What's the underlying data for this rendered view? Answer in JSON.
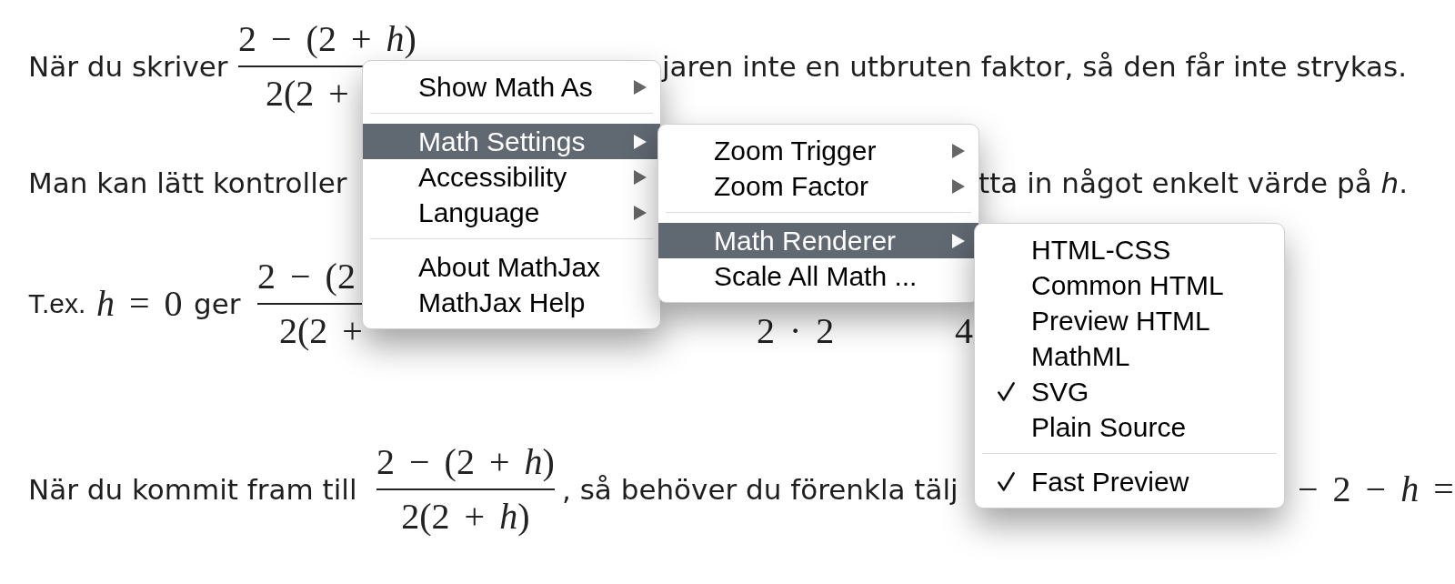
{
  "content": {
    "lines": [
      {
        "fragments": [
          {
            "kind": "text",
            "text": "När du skriver"
          },
          {
            "kind": "fraction",
            "numerator": "2 − (2 + *h*)",
            "denominator": "2(2 +"
          },
          {
            "kind": "text",
            "text": "jaren inte en utbruten faktor, så den får inte strykas."
          }
        ]
      },
      {
        "fragments": [
          {
            "kind": "text",
            "text": "Man kan lätt kontroller"
          },
          {
            "kind": "text",
            "text": "tta in något enkelt värde på *h*."
          }
        ]
      },
      {
        "fragments": [
          {
            "kind": "text",
            "text": "T.ex."
          },
          {
            "kind": "math",
            "text": "*h* = 0"
          },
          {
            "kind": "text",
            "text": "ger"
          },
          {
            "kind": "fraction",
            "numerator": "2 − (2",
            "denominator": "2(2 +"
          },
          {
            "kind": "denominator",
            "text": "2 · 2"
          },
          {
            "kind": "denominator",
            "text": "4"
          }
        ]
      },
      {
        "fragments": [
          {
            "kind": "text",
            "text": "När du kommit fram till"
          },
          {
            "kind": "fraction",
            "numerator": "2 − (2 + *h*)",
            "denominator": "2(2 + *h*)"
          },
          {
            "kind": "text",
            "text": ", så behöver du förenkla tälj"
          },
          {
            "kind": "math",
            "text": "− 2 − *h* ="
          }
        ]
      }
    ]
  },
  "context_menu": {
    "groups": [
      [
        {
          "kind": "submenu",
          "label": "Show Math As",
          "selected": false
        }
      ],
      [
        {
          "kind": "submenu",
          "label": "Math Settings",
          "selected": true
        },
        {
          "kind": "submenu",
          "label": "Accessibility",
          "selected": false
        },
        {
          "kind": "submenu",
          "label": "Language",
          "selected": false
        }
      ],
      [
        {
          "kind": "action",
          "label": "About MathJax",
          "selected": false
        },
        {
          "kind": "action",
          "label": "MathJax Help",
          "selected": false
        }
      ]
    ]
  },
  "settings_submenu": {
    "groups": [
      [
        {
          "kind": "submenu",
          "label": "Zoom Trigger",
          "selected": false
        },
        {
          "kind": "submenu",
          "label": "Zoom Factor",
          "selected": false
        }
      ],
      [
        {
          "kind": "submenu",
          "label": "Math Renderer",
          "selected": true
        },
        {
          "kind": "action",
          "label": "Scale All Math ...",
          "selected": false
        }
      ]
    ]
  },
  "renderer_submenu": {
    "groups": [
      [
        {
          "kind": "radio",
          "label": "HTML-CSS",
          "selected": false
        },
        {
          "kind": "radio",
          "label": "Common HTML",
          "selected": false
        },
        {
          "kind": "radio",
          "label": "Preview HTML",
          "selected": false
        },
        {
          "kind": "radio",
          "label": "MathML",
          "selected": false
        },
        {
          "kind": "radio",
          "label": "SVG",
          "selected": true
        },
        {
          "kind": "radio",
          "label": "Plain Source",
          "selected": false
        }
      ],
      [
        {
          "kind": "checkbox",
          "label": "Fast Preview",
          "checked": true
        }
      ]
    ]
  }
}
